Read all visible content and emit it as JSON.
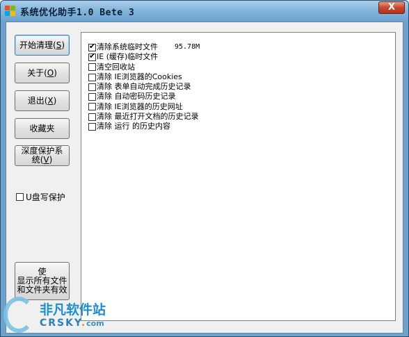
{
  "window": {
    "title": "系统优化助手1.0 Bete 3",
    "close_symbol": "X"
  },
  "buttons": {
    "start": {
      "label": "开始清理(",
      "key": "S",
      "tail": ")"
    },
    "about": {
      "label": "关于(",
      "key": "O",
      "tail": ")"
    },
    "exit": {
      "label": "退出(",
      "key": "X",
      "tail": ")"
    },
    "favorites": {
      "label": "收藏夹"
    },
    "deep_protect": {
      "line1": "深度保护系",
      "line2": "统(",
      "key": "V",
      "tail": ")"
    },
    "show_files": {
      "line1": "使",
      "line2": "显示所有文件",
      "line3": "和文件夹有效"
    }
  },
  "usb_protect": {
    "label": "U盘写保护",
    "checked": false
  },
  "clean_items": [
    {
      "label": "清除系统临时文件",
      "checked": true,
      "size": "95.78M"
    },
    {
      "label": "IE (缓存)临时文件",
      "checked": true
    },
    {
      "label": "清空回收站",
      "checked": false
    },
    {
      "label": "清除 IE浏览器的Cookies",
      "checked": false
    },
    {
      "label": "清除 表单自动完成历史记录",
      "checked": false
    },
    {
      "label": "清除 自动密码历史记录",
      "checked": false
    },
    {
      "label": "清除 IE浏览器的历史网址",
      "checked": false
    },
    {
      "label": "清除 最近打开文档的历史记录",
      "checked": false
    },
    {
      "label": "清除 运行 的历史内容",
      "checked": false
    }
  ],
  "watermark": {
    "cn": "非凡软件站",
    "en_main": "CRSKY",
    "en_dot": ".",
    "en_tail": "com"
  },
  "colors": {
    "title_bar": "#7eb2d9",
    "close_button": "#c7462f",
    "client_bg": "#f0f0f0"
  }
}
